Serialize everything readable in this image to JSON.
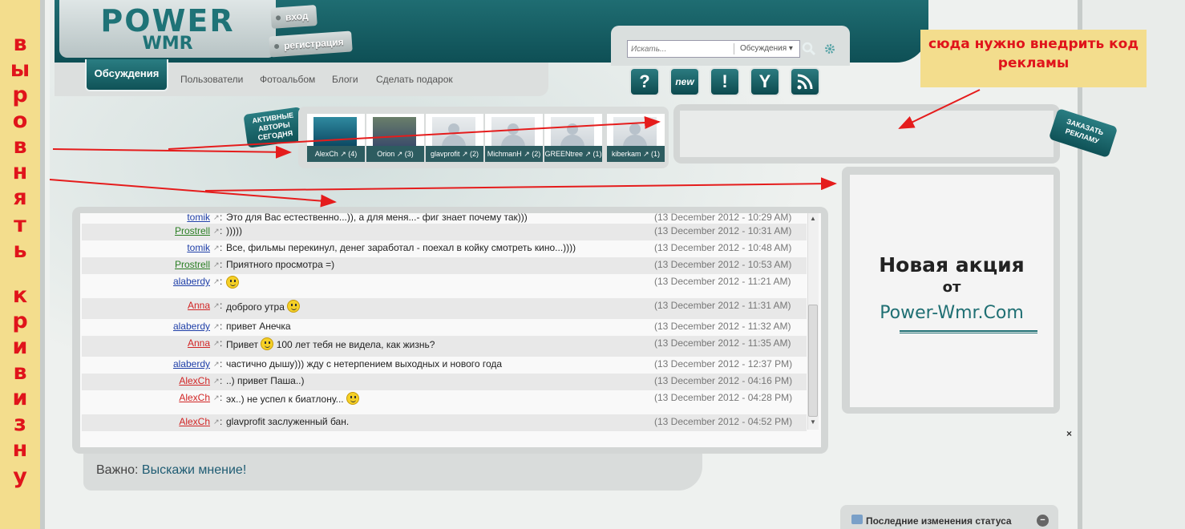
{
  "annotation": {
    "side_letters": [
      "в",
      "ы",
      "р",
      "о",
      "в",
      "н",
      "я",
      "т",
      "ь",
      "к",
      "р",
      "и",
      "в",
      "и",
      "з",
      "н",
      "у"
    ],
    "note": "сюда нужно внедрить код рекламы"
  },
  "header": {
    "logo_main": "POWER",
    "logo_sub": "WMR",
    "login": "вход",
    "register": "регистрация"
  },
  "nav": {
    "active": "Обсуждения",
    "items": [
      "Пользователи",
      "Фотоальбом",
      "Блоги",
      "Сделать подарок"
    ]
  },
  "search": {
    "placeholder": "Искать...",
    "category": "Обсуждения",
    "search_icon": "search-icon",
    "settings_icon": "gear-icon"
  },
  "toolbar_icons": [
    "?",
    "new",
    "!",
    "Y",
    "rss"
  ],
  "authors": {
    "label": "АКТИВНЫЕ АВТОРЫ СЕГОДНЯ",
    "list": [
      {
        "name": "AlexCh",
        "count": "(4)"
      },
      {
        "name": "Orion",
        "count": "(3)"
      },
      {
        "name": "glavprofit",
        "count": "(2)"
      },
      {
        "name": "MichmanH",
        "count": "(2)"
      },
      {
        "name": "GREENtree",
        "count": "(1)"
      },
      {
        "name": "kiberkam",
        "count": "(1)"
      }
    ]
  },
  "order_ad": "ЗАКАЗАТЬ РЕКЛАМУ",
  "promo": {
    "line1": "Новая акция",
    "line2": "от",
    "line3": "Power-Wmr.Com"
  },
  "chat": {
    "messages": [
      {
        "nick": "tomik",
        "color": "blue",
        "msg": "Это для Вас естественно...)), а для меня...- фиг знает почему так)))",
        "time": "(13 December 2012 - 10:29 AM)",
        "smiley": false
      },
      {
        "nick": "Prostrell",
        "color": "green",
        "msg": ")))))",
        "time": "(13 December 2012 - 10:31 AM)",
        "smiley": false
      },
      {
        "nick": "tomik",
        "color": "blue",
        "msg": "Все, фильмы перекинул, денег заработал - поехал в койку смотреть кино...))))",
        "time": "(13 December 2012 - 10:48 AM)",
        "smiley": false
      },
      {
        "nick": "Prostrell",
        "color": "green",
        "msg": "Приятного просмотра =)",
        "time": "(13 December 2012 - 10:53 AM)",
        "smiley": false
      },
      {
        "nick": "alaberdy",
        "color": "blue",
        "msg": "",
        "time": "(13 December 2012 - 11:21 AM)",
        "smiley": true
      },
      {
        "nick": "Anna",
        "color": "red",
        "msg": "доброго утра",
        "time": "(13 December 2012 - 11:31 AM)",
        "smiley": true
      },
      {
        "nick": "alaberdy",
        "color": "blue",
        "msg": "привет Анечка",
        "time": "(13 December 2012 - 11:32 AM)",
        "smiley": false
      },
      {
        "nick": "Anna",
        "color": "red",
        "msg": "Привет",
        "msg2": "100 лет тебя не видела, как жизнь?",
        "time": "(13 December 2012 - 11:35 AM)",
        "smiley": true
      },
      {
        "nick": "alaberdy",
        "color": "blue",
        "msg": "частично дышу))) жду с нетерпением выходных и нового года",
        "time": "(13 December 2012 - 12:37 PM)",
        "smiley": false
      },
      {
        "nick": "AlexCh",
        "color": "red",
        "msg": "..) привет Паша..)",
        "time": "(13 December 2012 - 04:16 PM)",
        "smiley": false
      },
      {
        "nick": "AlexCh",
        "color": "red",
        "msg": "эх..) не успел к биатлону...",
        "time": "(13 December 2012 - 04:28 PM)",
        "smiley": true
      },
      {
        "nick": "AlexCh",
        "color": "red",
        "msg": "glavprofit заслуженный бан.",
        "time": "(13 December 2012 - 04:52 PM)",
        "smiley": false
      }
    ]
  },
  "important": {
    "label": "Важно:",
    "text": "Выскажи мнение!"
  },
  "close": "×",
  "status": {
    "title": "Последние изменения статуса",
    "minimize": "−"
  }
}
